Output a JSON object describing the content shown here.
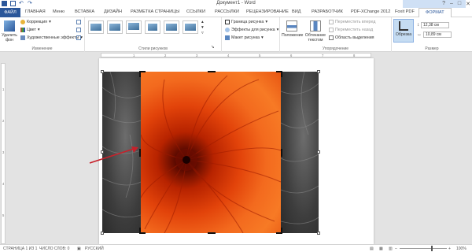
{
  "window": {
    "title": "Документ1 - Word"
  },
  "tabs": [
    {
      "label": "ФАЙЛ"
    },
    {
      "label": "ГЛАВНАЯ"
    },
    {
      "label": "Меню"
    },
    {
      "label": "ВСТАВКА"
    },
    {
      "label": "ДИЗАЙН"
    },
    {
      "label": "РАЗМЕТКА СТРАНИЦЫ"
    },
    {
      "label": "ССЫЛКИ"
    },
    {
      "label": "РАССЫЛКИ"
    },
    {
      "label": "РЕЦЕНЗИРОВАНИЕ"
    },
    {
      "label": "ВИД"
    },
    {
      "label": "РАЗРАБОТЧИК"
    },
    {
      "label": "PDF-XChange 2012"
    },
    {
      "label": "Foxit PDF"
    },
    {
      "label": "ФОРМАТ"
    }
  ],
  "ribbon": {
    "remove_bg": "Удалить фон",
    "correction": "Коррекция",
    "color": "Цвет",
    "artistic": "Художественные эффекты",
    "group_adjust": "Изменение",
    "group_styles": "Стили рисунков",
    "border": "Граница рисунка",
    "effects": "Эффекты для рисунка",
    "layout": "Макет рисунка",
    "position": "Положение",
    "wrap": "Обтекание текстом",
    "bring_forward": "Переместить вперед",
    "send_backward": "Переместить назад",
    "selection_pane": "Область выделения",
    "group_arrange": "Упорядочение",
    "crop": "Обрезка",
    "height": "12,38 см",
    "width": "10,89 см",
    "group_size": "Размер"
  },
  "status": {
    "page": "СТРАНИЦА 1 ИЗ 1",
    "words": "ЧИСЛО СЛОВ: 0",
    "language": "РУССКИЙ",
    "zoom": "100%"
  },
  "colors": {
    "accent": "#2b579a",
    "arrow": "#c8202a"
  },
  "icons": [
    "save-icon",
    "undo-icon",
    "redo-icon",
    "minimize-icon",
    "maximize-icon",
    "close-icon",
    "crop-icon",
    "arrow-pointer"
  ]
}
